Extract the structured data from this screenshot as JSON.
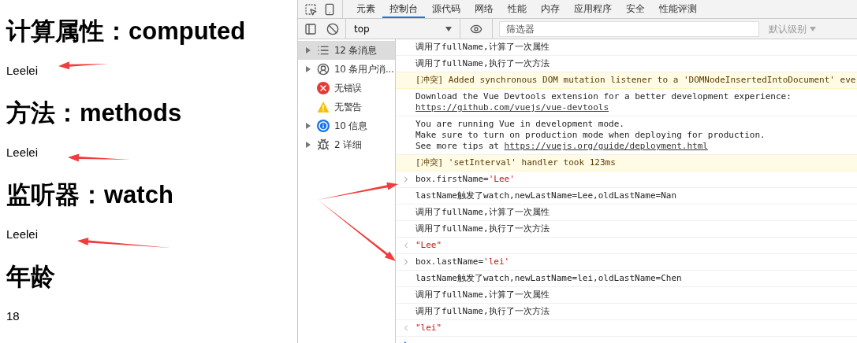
{
  "page": {
    "sections": [
      {
        "heading": "计算属性：computed",
        "value": "Leelei"
      },
      {
        "heading": "方法：methods",
        "value": "Leelei"
      },
      {
        "heading": "监听器：watch",
        "value": "Leelei"
      },
      {
        "heading": "年龄",
        "value": "18"
      }
    ]
  },
  "devtools": {
    "tabs": [
      {
        "label": "元素",
        "selected": false
      },
      {
        "label": "控制台",
        "selected": true
      },
      {
        "label": "源代码",
        "selected": false
      },
      {
        "label": "网络",
        "selected": false
      },
      {
        "label": "性能",
        "selected": false
      },
      {
        "label": "内存",
        "selected": false
      },
      {
        "label": "应用程序",
        "selected": false
      },
      {
        "label": "安全",
        "selected": false
      },
      {
        "label": "性能评测",
        "selected": false
      }
    ],
    "toolbar": {
      "context": "top",
      "filter_placeholder": "筛选器",
      "levels": "默认级别"
    },
    "sidebar": [
      {
        "kind": "list",
        "label": "12 条消息",
        "expandable": true,
        "selected": true
      },
      {
        "kind": "user",
        "label": "10 条用户消...",
        "expandable": true,
        "selected": false
      },
      {
        "kind": "error",
        "label": "无错误",
        "expandable": false,
        "selected": false
      },
      {
        "kind": "warning",
        "label": "无警告",
        "expandable": false,
        "selected": false
      },
      {
        "kind": "info",
        "label": "10 信息",
        "expandable": true,
        "selected": false
      },
      {
        "kind": "verbose",
        "label": "2 详细",
        "expandable": true,
        "selected": false
      }
    ],
    "console": [
      {
        "kind": "log",
        "lines": [
          [
            {
              "kind": "text",
              "text": "调用了fullName,计算了一次属性"
            }
          ]
        ]
      },
      {
        "kind": "log",
        "lines": [
          [
            {
              "kind": "text",
              "text": "调用了fullName,执行了一次方法"
            }
          ]
        ]
      },
      {
        "kind": "warning",
        "lines": [
          [
            {
              "kind": "text",
              "text": "[冲突] Added synchronous DOM mutation listener to a 'DOMNodeInsertedIntoDocument' eve"
            }
          ]
        ]
      },
      {
        "kind": "log",
        "lines": [
          [
            {
              "kind": "text",
              "text": "Download the Vue Devtools extension for a better development experience:"
            }
          ],
          [
            {
              "kind": "link",
              "text": "https://github.com/vuejs/vue-devtools"
            }
          ]
        ]
      },
      {
        "kind": "log",
        "lines": [
          [
            {
              "kind": "text",
              "text": "You are running Vue in development mode."
            }
          ],
          [
            {
              "kind": "text",
              "text": "Make sure to turn on production mode when deploying for production."
            }
          ],
          [
            {
              "kind": "text",
              "text": "See more tips at "
            },
            {
              "kind": "link",
              "text": "https://vuejs.org/guide/deployment.html"
            }
          ]
        ]
      },
      {
        "kind": "warning",
        "lines": [
          [
            {
              "kind": "text",
              "text": "[冲突] 'setInterval' handler took 123ms"
            }
          ]
        ]
      },
      {
        "kind": "input",
        "lines": [
          [
            {
              "kind": "text",
              "text": "box.firstName="
            },
            {
              "kind": "string",
              "text": "'Lee'"
            }
          ]
        ]
      },
      {
        "kind": "log",
        "lines": [
          [
            {
              "kind": "text",
              "text": "lastName触发了watch,newLastName=Lee,oldLastName=Nan"
            }
          ]
        ]
      },
      {
        "kind": "log",
        "lines": [
          [
            {
              "kind": "text",
              "text": "调用了fullName,计算了一次属性"
            }
          ]
        ]
      },
      {
        "kind": "log",
        "lines": [
          [
            {
              "kind": "text",
              "text": "调用了fullName,执行了一次方法"
            }
          ]
        ]
      },
      {
        "kind": "result",
        "lines": [
          [
            {
              "kind": "string",
              "text": "\"Lee\""
            }
          ]
        ]
      },
      {
        "kind": "input",
        "lines": [
          [
            {
              "kind": "text",
              "text": "box.lastName="
            },
            {
              "kind": "string",
              "text": "'lei'"
            }
          ]
        ]
      },
      {
        "kind": "log",
        "lines": [
          [
            {
              "kind": "text",
              "text": "lastName触发了watch,newLastName=lei,oldLastName=Chen"
            }
          ]
        ]
      },
      {
        "kind": "log",
        "lines": [
          [
            {
              "kind": "text",
              "text": "调用了fullName,计算了一次属性"
            }
          ]
        ]
      },
      {
        "kind": "log",
        "lines": [
          [
            {
              "kind": "text",
              "text": "调用了fullName,执行了一次方法"
            }
          ]
        ]
      },
      {
        "kind": "result",
        "lines": [
          [
            {
              "kind": "string",
              "text": "\"lei\""
            }
          ]
        ]
      },
      {
        "kind": "prompt"
      }
    ]
  }
}
